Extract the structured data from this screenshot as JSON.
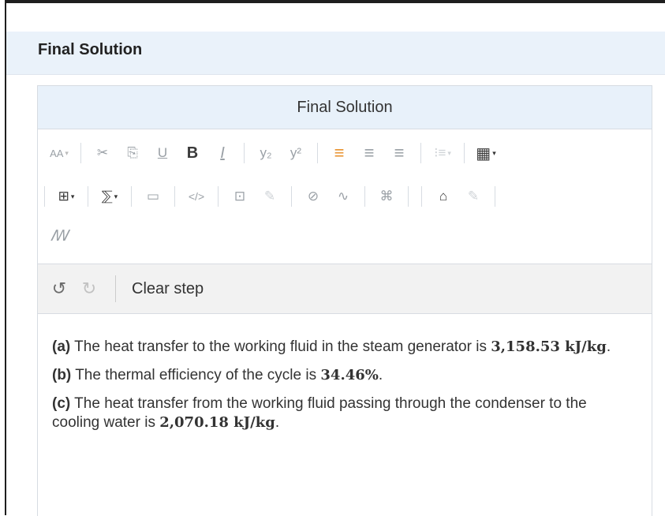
{
  "section": {
    "title": "Final Solution"
  },
  "editor": {
    "title": "Final Solution",
    "toolbar": {
      "row1": [
        "AA",
        "✂",
        "⎘",
        "U",
        "B",
        "I",
        "y₂",
        "y²",
        "≡",
        "≡",
        "≡",
        "⁝≡",
        "▦"
      ],
      "row2": [
        "⊞",
        "⅀",
        "▭",
        "</>",
        "⊡",
        "✎",
        "⊘",
        "∿",
        "⌘",
        "⌂",
        "✎"
      ],
      "row3": [
        "ꟿ"
      ]
    },
    "undo_bar": {
      "clear_step": "Clear step"
    },
    "content": {
      "a_label": "(a)",
      "a_text": "The heat transfer to the working fluid in the steam generator is",
      "a_value": "3,158.53 kJ/kg",
      "a_end": ".",
      "b_label": "(b)",
      "b_text": "The thermal efficiency of the cycle is",
      "b_value": "34.46%",
      "b_end": ".",
      "c_label": "(c)",
      "c_text": "The heat transfer from the working fluid passing through the condenser to the cooling water is",
      "c_value": "2,070.18 kJ/kg",
      "c_end": "."
    }
  }
}
